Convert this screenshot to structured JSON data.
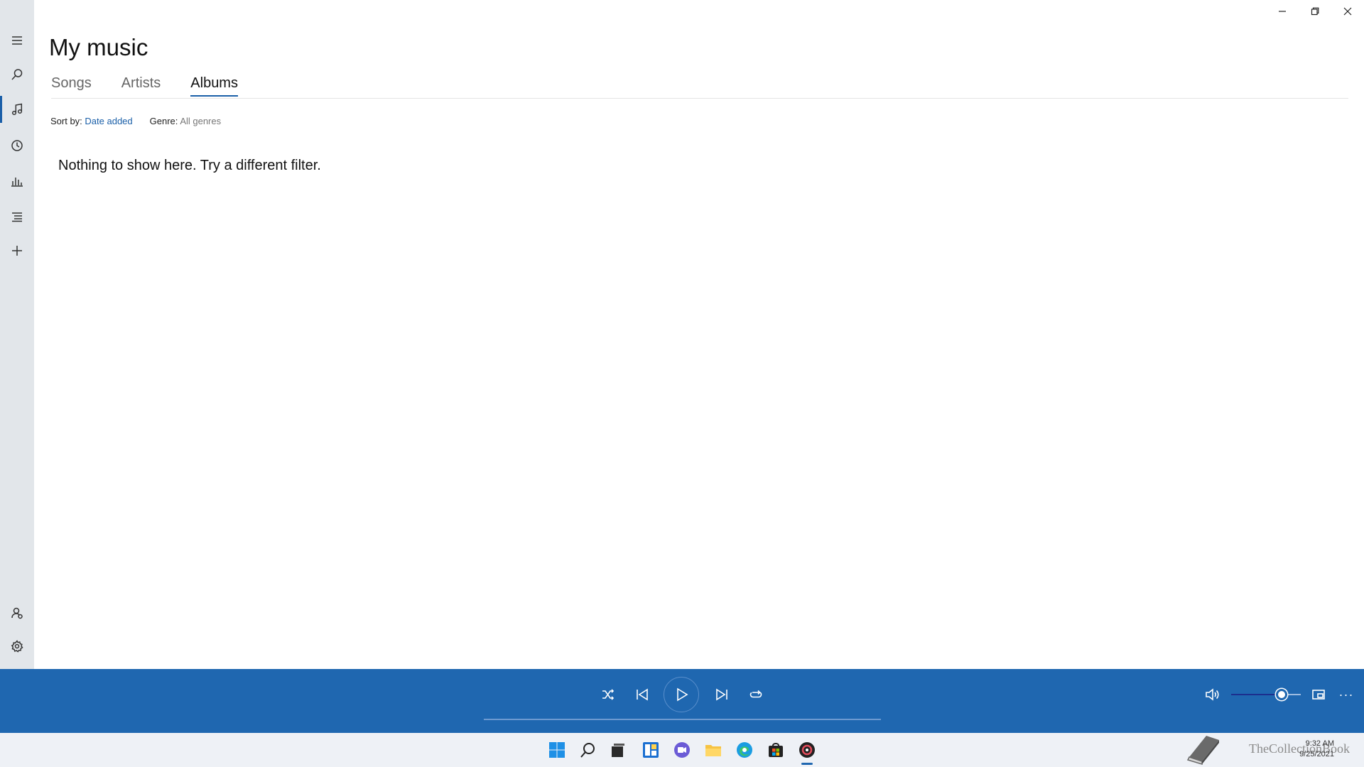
{
  "page": {
    "title": "My music",
    "tabs": [
      {
        "label": "Songs",
        "active": false
      },
      {
        "label": "Artists",
        "active": false
      },
      {
        "label": "Albums",
        "active": true
      }
    ],
    "sort_label": "Sort by:",
    "sort_value": "Date added",
    "genre_label": "Genre:",
    "genre_value": "All genres",
    "empty_message": "Nothing to show here. Try a different filter."
  },
  "rail": {
    "items": [
      "menu-icon",
      "search-icon",
      "music-note-icon",
      "recent-icon",
      "charts-icon",
      "playlist-icon",
      "add-icon"
    ],
    "bottom": [
      "account-icon",
      "gear-icon"
    ],
    "active": "music-note-icon"
  },
  "window_controls": [
    "minimize-icon",
    "maximize-icon",
    "close-icon"
  ],
  "player": {
    "controls": [
      "shuffle-icon",
      "previous-icon",
      "play-icon",
      "next-icon",
      "repeat-icon"
    ],
    "volume_level": 0.78,
    "more_label": "···"
  },
  "taskbar": {
    "icons": [
      "windows-start-icon",
      "search-icon",
      "task-view-icon",
      "widgets-icon",
      "teams-chat-icon",
      "file-explorer-icon",
      "edge-icon",
      "store-icon",
      "groove-music-icon"
    ],
    "time": "9:32 AM",
    "date": "9/25/2021",
    "watermark": "TheCollectionBook"
  },
  "colors": {
    "accent": "#1a5fa8",
    "player_bg": "#1f67b0",
    "rail_bg": "#e2e6ea",
    "taskbar_bg": "#eef1f6"
  }
}
